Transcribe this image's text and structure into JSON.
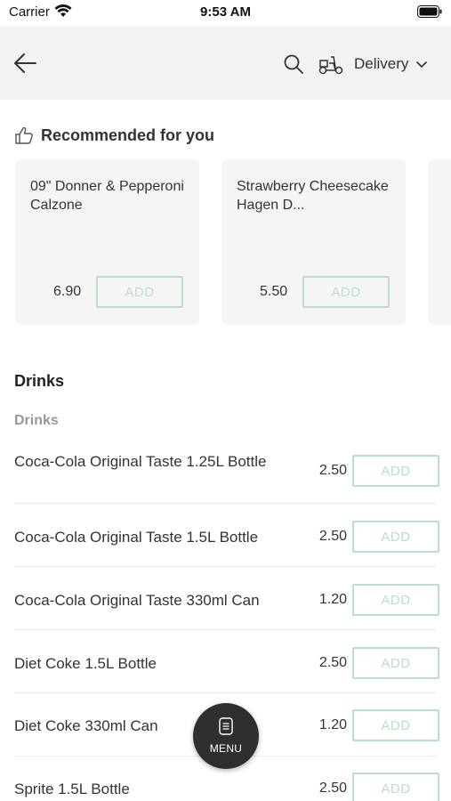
{
  "status_bar": {
    "carrier": "Carrier",
    "time": "9:53 AM"
  },
  "header": {
    "delivery_label": "Delivery"
  },
  "recommended": {
    "title": "Recommended for you",
    "items": [
      {
        "name": "09\" Donner & Pepperoni Calzone",
        "price": "6.90",
        "add_label": "ADD"
      },
      {
        "name": "Strawberry Cheesecake Hagen D...",
        "price": "5.50",
        "add_label": "ADD"
      }
    ]
  },
  "section": {
    "title": "Drinks",
    "subtitle": "Drinks",
    "items": [
      {
        "name": "Coca-Cola Original Taste 1.25L Bottle",
        "price": "2.50",
        "add_label": "ADD"
      },
      {
        "name": "Coca-Cola Original Taste 1.5L Bottle",
        "price": "2.50",
        "add_label": "ADD"
      },
      {
        "name": "Coca-Cola Original Taste 330ml Can",
        "price": "1.20",
        "add_label": "ADD"
      },
      {
        "name": "Diet Coke 1.5L Bottle",
        "price": "2.50",
        "add_label": "ADD"
      },
      {
        "name": "Diet Coke 330ml Can",
        "price": "1.20",
        "add_label": "ADD"
      },
      {
        "name": "Sprite 1.5L Bottle",
        "price": "2.50",
        "add_label": "ADD"
      }
    ]
  },
  "menu_button": {
    "label": "MENU"
  },
  "colors": {
    "accent_add": "#b9dfc6",
    "header_bg": "#f2f2f2",
    "card_bg": "#f5f5f5",
    "fab_bg": "#2f2f2f"
  }
}
